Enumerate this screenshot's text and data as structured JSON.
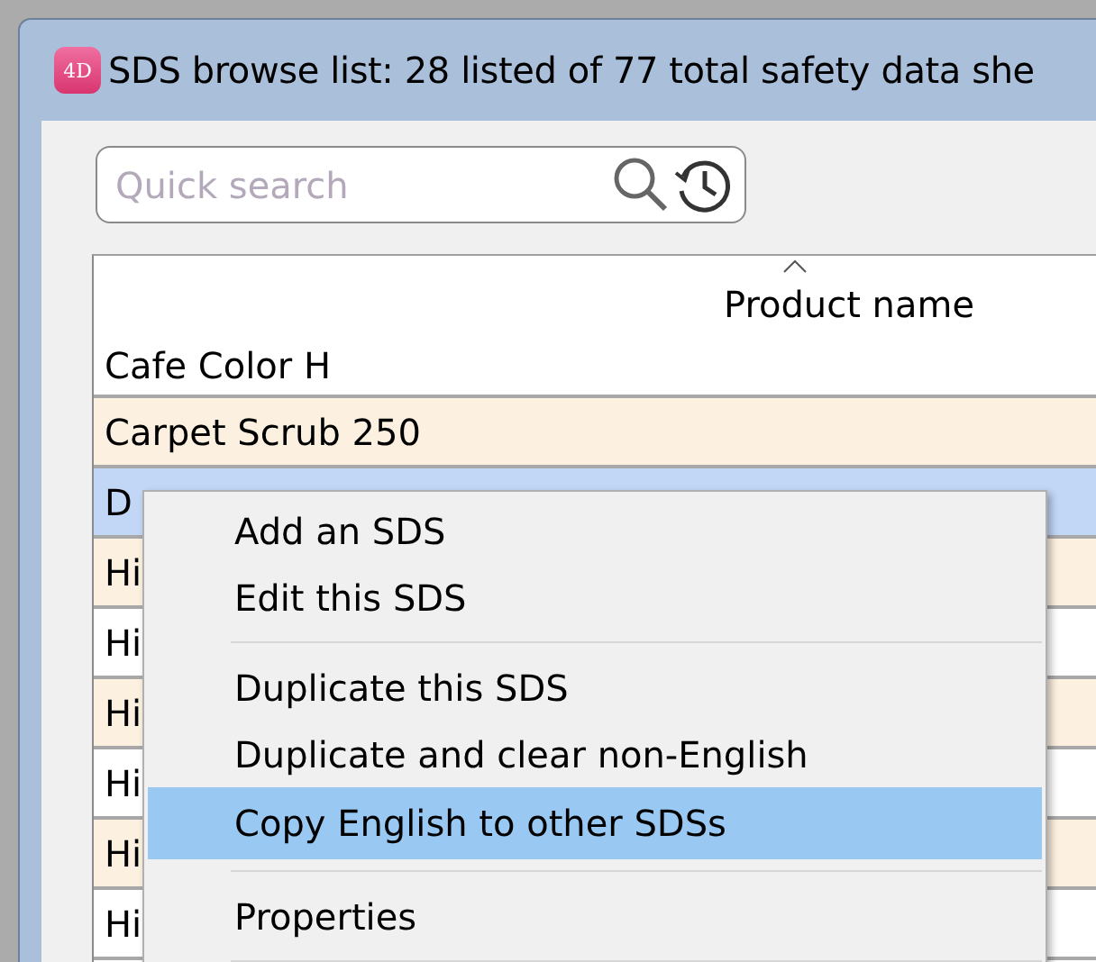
{
  "window": {
    "title": "SDS browse list: 28 listed of 77 total safety data she",
    "icon_label": "4D"
  },
  "search": {
    "placeholder": "Quick search"
  },
  "table": {
    "columns": [
      {
        "label": "Product name",
        "sorted": true
      }
    ],
    "rows": [
      {
        "cells": [
          "Cafe Color H"
        ],
        "selected": false
      },
      {
        "cells": [
          "Carpet Scrub 250"
        ],
        "selected": false
      },
      {
        "cells": [
          "D"
        ],
        "selected": true
      },
      {
        "cells": [
          "Hi"
        ],
        "selected": false
      },
      {
        "cells": [
          "Hi"
        ],
        "selected": false
      },
      {
        "cells": [
          "Hi"
        ],
        "selected": false
      },
      {
        "cells": [
          "Hi"
        ],
        "selected": false
      },
      {
        "cells": [
          "Hi"
        ],
        "selected": false
      },
      {
        "cells": [
          "Hi"
        ],
        "selected": false
      }
    ]
  },
  "context_menu": {
    "items": [
      {
        "kind": "item",
        "label": "Add an SDS",
        "selected": false
      },
      {
        "kind": "item",
        "label": "Edit this SDS",
        "selected": false
      },
      {
        "kind": "separator"
      },
      {
        "kind": "item",
        "label": "Duplicate this SDS",
        "selected": false
      },
      {
        "kind": "item",
        "label": "Duplicate and clear non-English",
        "selected": false
      },
      {
        "kind": "item",
        "label": "Copy English to other SDSs",
        "selected": true
      },
      {
        "kind": "separator"
      },
      {
        "kind": "item",
        "label": "Properties",
        "selected": false
      },
      {
        "kind": "separator"
      }
    ]
  }
}
